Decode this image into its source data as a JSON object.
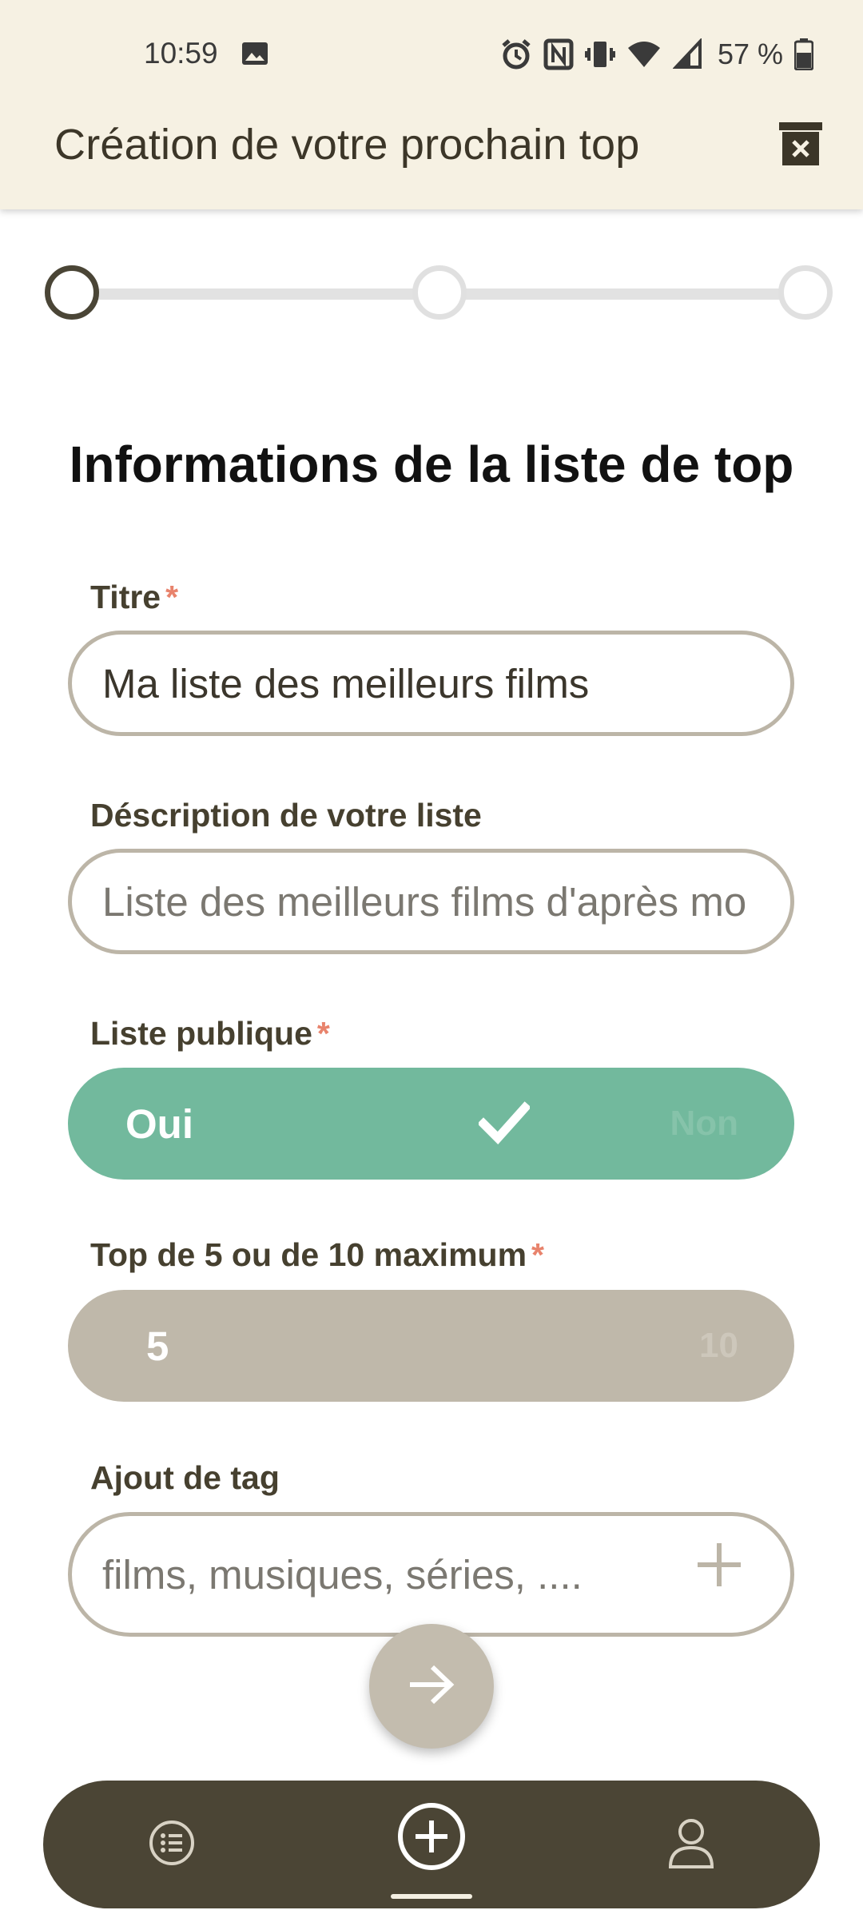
{
  "status_bar": {
    "time": "10:59",
    "battery_percent": "57 %",
    "icons": [
      "image-icon",
      "alarm-icon",
      "nfc-icon",
      "vibrate-icon",
      "wifi-icon",
      "signal-icon",
      "battery-icon"
    ]
  },
  "app_bar": {
    "title": "Création de votre prochain top",
    "action_icon": "trash-icon"
  },
  "stepper": {
    "current_step": 1,
    "total_steps": 3
  },
  "section": {
    "title": "Informations de la liste de top"
  },
  "form": {
    "title_field": {
      "label": "Titre",
      "required_mark": "*",
      "value": "Ma liste des meilleurs films"
    },
    "description_field": {
      "label": "Déscription de votre liste",
      "placeholder": "Liste des meilleurs films d'après mo"
    },
    "public_toggle": {
      "label": "Liste publique",
      "required_mark": "*",
      "on_label": "Oui",
      "off_label": "Non",
      "checked": true,
      "icon": "check-icon"
    },
    "top_size_toggle": {
      "label": "Top de 5 ou de 10 maximum",
      "required_mark": "*",
      "left_label": "5",
      "right_label": "10",
      "selected": "5"
    },
    "tag_field": {
      "label": "Ajout de tag",
      "placeholder": "films, musiques, séries, ....",
      "add_icon": "plus-icon"
    }
  },
  "next_button": {
    "icon": "arrow-right-icon"
  },
  "bottom_nav": {
    "items": [
      {
        "icon": "list-icon",
        "active": false
      },
      {
        "icon": "add-circle-icon",
        "active": true
      },
      {
        "icon": "profile-icon",
        "active": false
      }
    ]
  },
  "colors": {
    "app_bar_bg": "#f6f1e3",
    "dark": "#4b4535",
    "green": "#72b99d",
    "grey_toggle": "#bfb8aa",
    "required": "#e8836c"
  }
}
